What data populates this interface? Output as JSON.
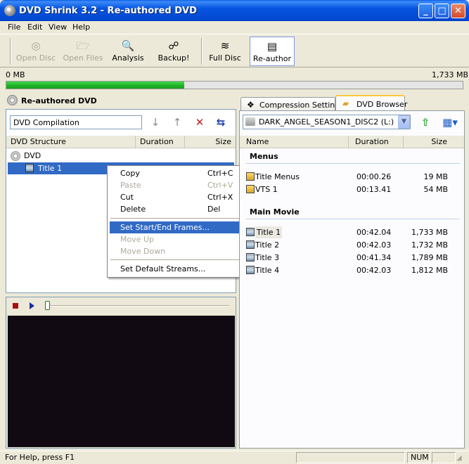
{
  "window": {
    "title": "DVD Shrink 3.2 - Re-authored DVD"
  },
  "menu": [
    "File",
    "Edit",
    "View",
    "Help"
  ],
  "toolbar": {
    "open_disc": "Open Disc",
    "open_files": "Open Files",
    "analysis": "Analysis",
    "backup": "Backup!",
    "full_disc": "Full Disc",
    "reauthor": "Re-author"
  },
  "progress": {
    "left_label": "0 MB",
    "right_label": "1,733 MB",
    "fill_fraction": 0.39
  },
  "left_panel": {
    "title": "Re-authored DVD",
    "compilation_name": "DVD Compilation",
    "columns": [
      "DVD Structure",
      "Duration",
      "Size"
    ],
    "tree": {
      "root": "DVD",
      "child": "Title 1"
    }
  },
  "context_menu": [
    {
      "label": "Copy",
      "shortcut": "Ctrl+C",
      "disabled": false
    },
    {
      "label": "Paste",
      "shortcut": "Ctrl+V",
      "disabled": true
    },
    {
      "label": "Cut",
      "shortcut": "Ctrl+X",
      "disabled": false
    },
    {
      "label": "Delete",
      "shortcut": "Del",
      "disabled": false
    },
    {
      "label": "Set Start/End Frames...",
      "shortcut": "",
      "disabled": false,
      "selected": true
    },
    {
      "label": "Move Up",
      "shortcut": "",
      "disabled": true
    },
    {
      "label": "Move Down",
      "shortcut": "",
      "disabled": true
    },
    {
      "label": "Set Default Streams...",
      "shortcut": "",
      "disabled": false
    }
  ],
  "right_panel": {
    "tabs": {
      "compression": "Compression Settings",
      "browser": "DVD Browser"
    },
    "drive": "DARK_ANGEL_SEASON1_DISC2 (L:)",
    "columns": [
      "Name",
      "Duration",
      "Size"
    ],
    "menus_group": "Menus",
    "menus": [
      {
        "name": "Title Menus",
        "duration": "00:00.26",
        "size": "19 MB"
      },
      {
        "name": "VTS 1",
        "duration": "00:13.41",
        "size": "54 MB"
      }
    ],
    "movie_group": "Main Movie",
    "titles": [
      {
        "name": "Title 1",
        "duration": "00:42.04",
        "size": "1,733 MB"
      },
      {
        "name": "Title 2",
        "duration": "00:42.03",
        "size": "1,732 MB"
      },
      {
        "name": "Title 3",
        "duration": "00:41.34",
        "size": "1,789 MB"
      },
      {
        "name": "Title 4",
        "duration": "00:42.03",
        "size": "1,812 MB"
      }
    ]
  },
  "status": {
    "text": "For Help, press F1",
    "num": "NUM"
  }
}
